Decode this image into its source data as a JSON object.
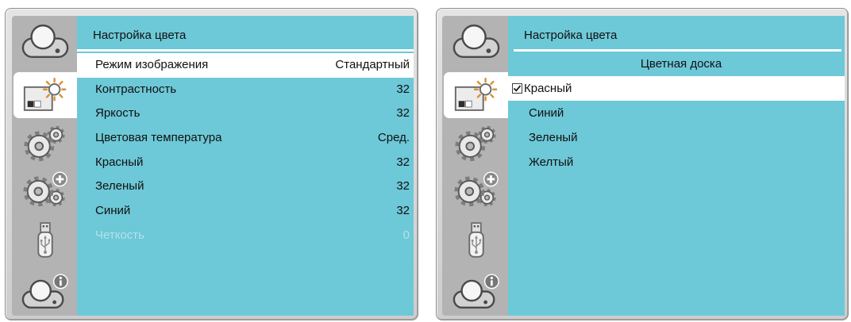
{
  "colors": {
    "menu_background": "#6dc8d7",
    "sidebar_background": "#b3b3b3",
    "frame": "#cdcdcd",
    "selected_background": "#ffffff",
    "text": "#111111",
    "disabled_text": "#b3e2ea"
  },
  "left_panel": {
    "sidebar": {
      "items": [
        {
          "icon": "projector-icon",
          "selected": false
        },
        {
          "icon": "picture-sun-icon",
          "selected": true
        },
        {
          "icon": "gears-icon",
          "selected": false
        },
        {
          "icon": "gears-plus-icon",
          "selected": false
        },
        {
          "icon": "usb-icon",
          "selected": false
        },
        {
          "icon": "projector-info-icon",
          "selected": false
        }
      ]
    },
    "title": "Настройка цвета",
    "rows": [
      {
        "label": "Режим изображения",
        "value": "Стандартный",
        "selected": true,
        "enabled": true
      },
      {
        "label": "Контрастность",
        "value": "32",
        "selected": false,
        "enabled": true
      },
      {
        "label": "Яркость",
        "value": "32",
        "selected": false,
        "enabled": true
      },
      {
        "label": "Цветовая температура",
        "value": "Сред.",
        "selected": false,
        "enabled": true
      },
      {
        "label": "Красный",
        "value": "32",
        "selected": false,
        "enabled": true
      },
      {
        "label": "Зеленый",
        "value": "32",
        "selected": false,
        "enabled": true
      },
      {
        "label": "Синий",
        "value": "32",
        "selected": false,
        "enabled": true
      },
      {
        "label": "Четкость",
        "value": "0",
        "selected": false,
        "enabled": false
      }
    ]
  },
  "right_panel": {
    "sidebar": {
      "items": [
        {
          "icon": "projector-icon",
          "selected": false
        },
        {
          "icon": "picture-sun-icon",
          "selected": true
        },
        {
          "icon": "gears-icon",
          "selected": false
        },
        {
          "icon": "gears-plus-icon",
          "selected": false
        },
        {
          "icon": "usb-icon",
          "selected": false
        },
        {
          "icon": "projector-info-icon",
          "selected": false
        }
      ]
    },
    "title": "Настройка цвета",
    "subtitle": "Цветная доска",
    "options": [
      {
        "label": "Красный",
        "checked": true,
        "selected": true
      },
      {
        "label": "Синий",
        "checked": false,
        "selected": false
      },
      {
        "label": "Зеленый",
        "checked": false,
        "selected": false
      },
      {
        "label": "Желтый",
        "checked": false,
        "selected": false
      }
    ]
  }
}
